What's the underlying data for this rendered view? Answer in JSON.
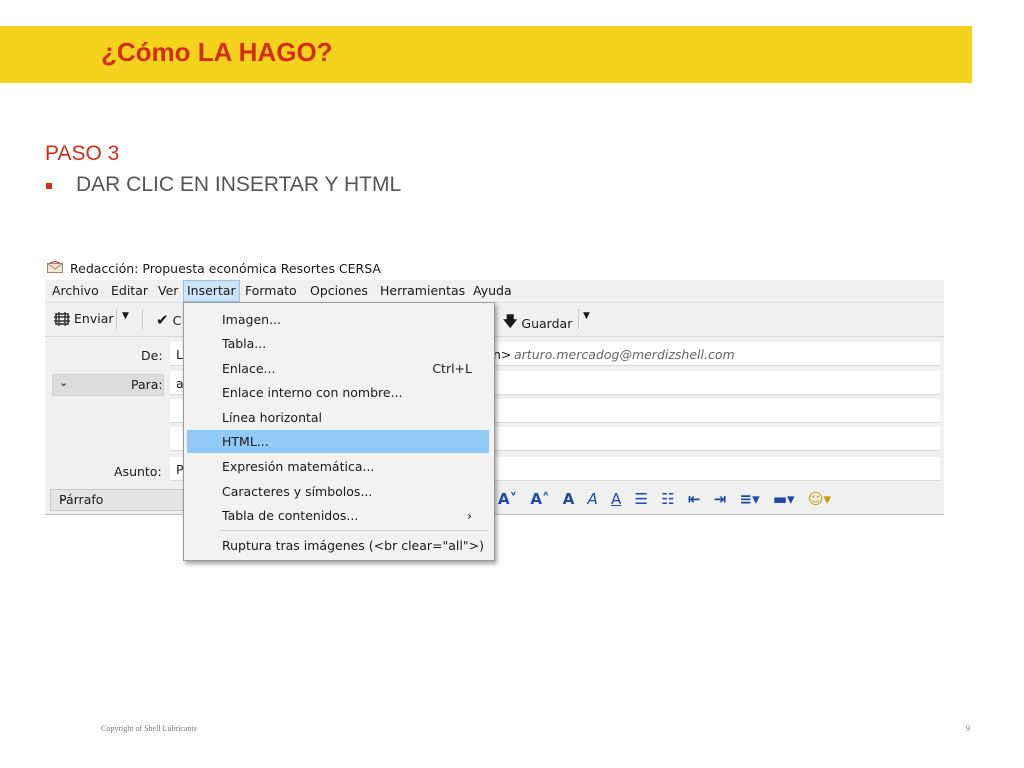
{
  "slide": {
    "title": "¿Cómo LA HAGO?",
    "step_label": "PASO 3",
    "bullet": "DAR CLIC EN INSERTAR Y HTML",
    "footer_copyright": "Copyright of Shell Lubricants",
    "page_number": "9",
    "colors": {
      "banner": "#f5d21b",
      "title": "#d42e12",
      "highlight": "#91c9f7"
    }
  },
  "window": {
    "title": "Redacción: Propuesta económica Resortes CERSA",
    "menu": [
      "Archivo",
      "Editar",
      "Ver",
      "Insertar",
      "Formato",
      "Opciones",
      "Herramientas",
      "Ayuda"
    ],
    "toolbar": {
      "send": "Enviar",
      "check_partial": "C",
      "save": "Guardar"
    },
    "fields": {
      "from_label": "De:",
      "from_value_partial": "L",
      "from_email_suffix": "n>",
      "from_email": "arturo.mercadog@merdizshell.com",
      "to_label": "Para:",
      "to_value_partial": "a",
      "subject_label": "Asunto:",
      "subject_value_partial": "P"
    },
    "format": {
      "paragraph": "Párrafo"
    }
  },
  "insert_menu": {
    "items": [
      {
        "label": "Imagen...",
        "shortcut": ""
      },
      {
        "label": "Tabla...",
        "shortcut": ""
      },
      {
        "label": "Enlace...",
        "shortcut": "Ctrl+L"
      },
      {
        "label": "Enlace interno con nombre...",
        "shortcut": ""
      },
      {
        "label": "Línea horizontal",
        "shortcut": ""
      },
      {
        "label": "HTML...",
        "shortcut": ""
      },
      {
        "label": "Expresión matemática...",
        "shortcut": ""
      },
      {
        "label": "Caracteres y símbolos...",
        "shortcut": ""
      },
      {
        "label": "Tabla de contenidos...",
        "shortcut": "›"
      },
      {
        "label": "Ruptura tras imágenes (<br clear=\"all\">)",
        "shortcut": ""
      }
    ],
    "highlighted": "HTML..."
  }
}
